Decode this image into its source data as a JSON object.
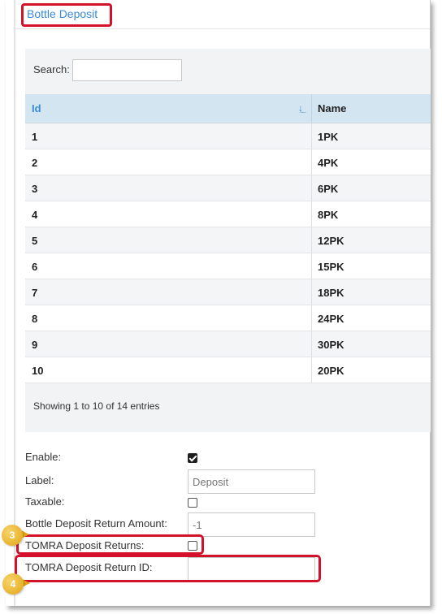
{
  "panel": {
    "title": "Bottle Deposit"
  },
  "search": {
    "label": "Search:",
    "value": ""
  },
  "table": {
    "columns": [
      "Id",
      "Name"
    ],
    "rows": [
      {
        "id": "1",
        "name": "1PK"
      },
      {
        "id": "2",
        "name": "4PK"
      },
      {
        "id": "3",
        "name": "6PK"
      },
      {
        "id": "4",
        "name": "8PK"
      },
      {
        "id": "5",
        "name": "12PK"
      },
      {
        "id": "6",
        "name": "15PK"
      },
      {
        "id": "7",
        "name": "18PK"
      },
      {
        "id": "8",
        "name": "24PK"
      },
      {
        "id": "9",
        "name": "30PK"
      },
      {
        "id": "10",
        "name": "20PK"
      }
    ],
    "info": "Showing 1 to 10 of 14 entries"
  },
  "form": {
    "enable": {
      "label": "Enable:",
      "checked": true
    },
    "label": {
      "label": "Label:",
      "placeholder": "Deposit"
    },
    "taxable": {
      "label": "Taxable:",
      "checked": false
    },
    "return_amount": {
      "label": "Bottle Deposit Return Amount:",
      "placeholder": "-1"
    },
    "tomra_returns": {
      "label": "TOMRA Deposit Returns:",
      "checked": false
    },
    "tomra_return_id": {
      "label": "TOMRA Deposit Return ID:",
      "value": ""
    }
  },
  "callouts": [
    "3",
    "4"
  ],
  "colors": {
    "accent": "#3b8ad4",
    "highlight": "#d3112a",
    "callout": "#e2a412",
    "header_bg": "#d4e5f2"
  }
}
